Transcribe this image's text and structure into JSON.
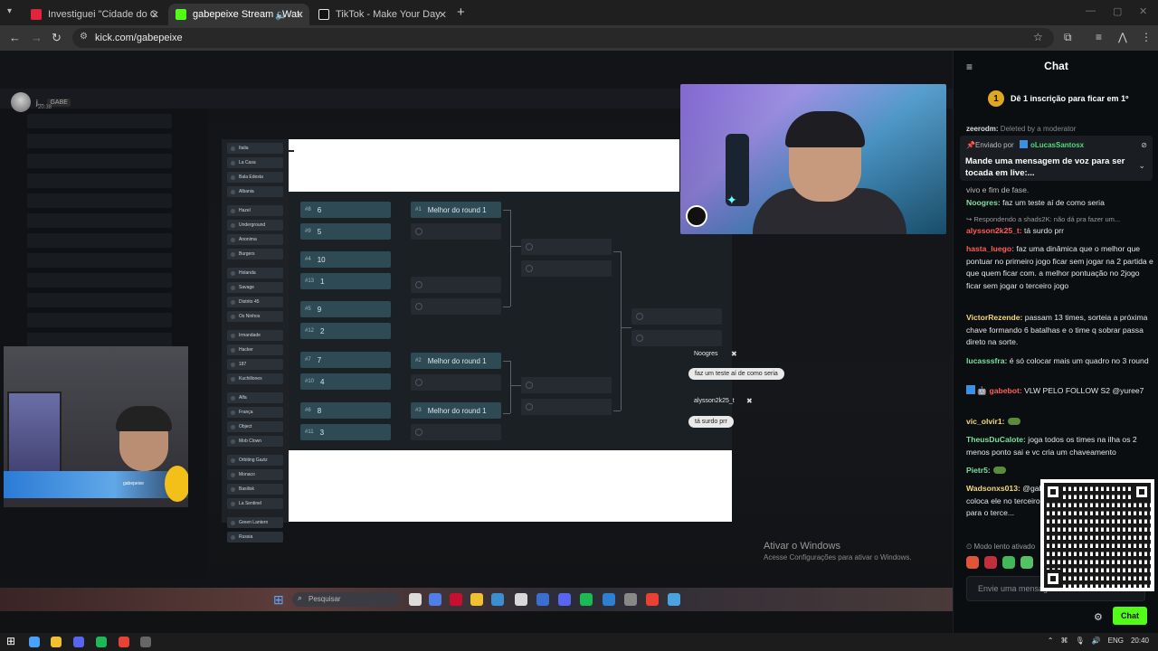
{
  "browser": {
    "tabs": [
      {
        "title": "Investiguei \"Cidade do Crime\"",
        "active": false,
        "favicon_color": "#e0243a"
      },
      {
        "title": "gabepeixe Stream - Watch",
        "active": true,
        "favicon_color": "#53fc18"
      },
      {
        "title": "TikTok - Make Your Day",
        "active": false,
        "favicon_color": "#e6e6e6"
      }
    ],
    "url": "kick.com/gabepeixe"
  },
  "stream": {
    "streamer_name": "j...",
    "streamer_tag": "GABE",
    "stream_time": "20:38",
    "teams": [
      "Italia",
      "La Casa",
      "Bala Edesta",
      "Albania",
      "Hazel",
      "Underground",
      "Anonima",
      "Burgers",
      "Holanda",
      "Savage",
      "Distrito 45",
      "Os Ninhos",
      "Irmandade",
      "Hacker",
      "187",
      "Kuchillones",
      "Alfa",
      "França",
      "Object",
      "Mob Clown",
      "Orbiting Gaziz",
      "Monaco",
      "Basilisk",
      "La Sentinel",
      "Green Lantern",
      "Russia"
    ],
    "bracket": {
      "round1": [
        {
          "seed": "#8",
          "team": "6"
        },
        {
          "seed": "#9",
          "team": "5"
        },
        {
          "seed": "#4",
          "team": "10"
        },
        {
          "seed": "#13",
          "team": "1"
        },
        {
          "seed": "#5",
          "team": "9"
        },
        {
          "seed": "#12",
          "team": "2"
        },
        {
          "seed": "#7",
          "team": "7"
        },
        {
          "seed": "#10",
          "team": "4"
        },
        {
          "seed": "#6",
          "team": "8"
        },
        {
          "seed": "#11",
          "team": "3"
        }
      ],
      "round2_labels": [
        {
          "seed": "#1",
          "label": "Melhor do round 1"
        },
        {
          "seed": "#2",
          "label": "Melhor do round 1"
        },
        {
          "seed": "#3",
          "label": "Melhor do round 1"
        }
      ]
    },
    "overlay_messages": [
      {
        "user": "Noogres",
        "text": "faz um teste aí de como seria"
      },
      {
        "user": "alysson2k25_t",
        "text": "tá surdo prr"
      }
    ],
    "tiny_cam_name": "gabepeixe",
    "activate_title": "Ativar o Windows",
    "activate_sub": "Acesse Configurações para ativar o Windows.",
    "inner_search": "Pesquisar"
  },
  "chat": {
    "title": "Chat",
    "promo_badge": "1",
    "promo_text": "Dê 1 inscrição para ficar em 1º",
    "deleted_user": "zeerodm:",
    "deleted_text": "Deleted by a moderator",
    "pinned": {
      "sent_by_label": "Enviado por",
      "user": "oLucasSantosx",
      "message": "Mande uma mensagem de voz para ser tocada em live:..."
    },
    "partial_line": "vivo e fim de fase.",
    "messages": [
      {
        "user": "Noogres:",
        "color": "#7ce0a0",
        "text": " faz um teste aí de como seria"
      },
      {
        "reply": "Respondendo a shads2K: não dá pra fazer um..."
      },
      {
        "user": "alysson2k25_t:",
        "color": "#ff5b5b",
        "text": " tá surdo prr"
      },
      {
        "user": "hasta_luego:",
        "color": "#ff5b5b",
        "text": " faz uma dinâmica que o melhor que pontuar no primeiro jogo ficar sem jogar na 2 partida e que quem ficar com. a melhor pontuação no 2jogo ficar sem jogar o terceiro jogo"
      },
      {
        "user": "VictorRezende:",
        "color": "#f5d97a",
        "text": " passam 13 times, sorteia a próxima chave formando 6 batalhas e o time q sobrar passa direto na sorte."
      },
      {
        "user": "lucasssfra:",
        "color": "#7ce0a0",
        "text": " é só colocar mais um quadro no 3 round"
      },
      {
        "user": "gabebot:",
        "color": "#ff5b5b",
        "text": " VLW PELO FOLLOW S2 @yuree7"
      },
      {
        "user": "vic_olvir1:",
        "color": "#f5d97a",
        "text": ""
      },
      {
        "user": "TheusDuCalote:",
        "color": "#7ce0a0",
        "text": " joga todos os times na ilha os 2 menos ponto sai e vc cria um chaveamento"
      },
      {
        "user": "Pietr5:",
        "color": "#7ce0a0",
        "text": ""
      },
      {
        "user": "Wadsonxs013:",
        "color": "#f5d97a",
        "text": " @gabepeixe vai sobrar um, aí vc coloca ele no terceiro já. aí voce coloca o time que foi para o terce..."
      }
    ],
    "slow_mode": "Modo lento ativado",
    "input_placeholder": "Envie uma mensagem",
    "send_label": "Chat"
  },
  "taskbar": {
    "language": "ENG",
    "time": "20:40"
  }
}
